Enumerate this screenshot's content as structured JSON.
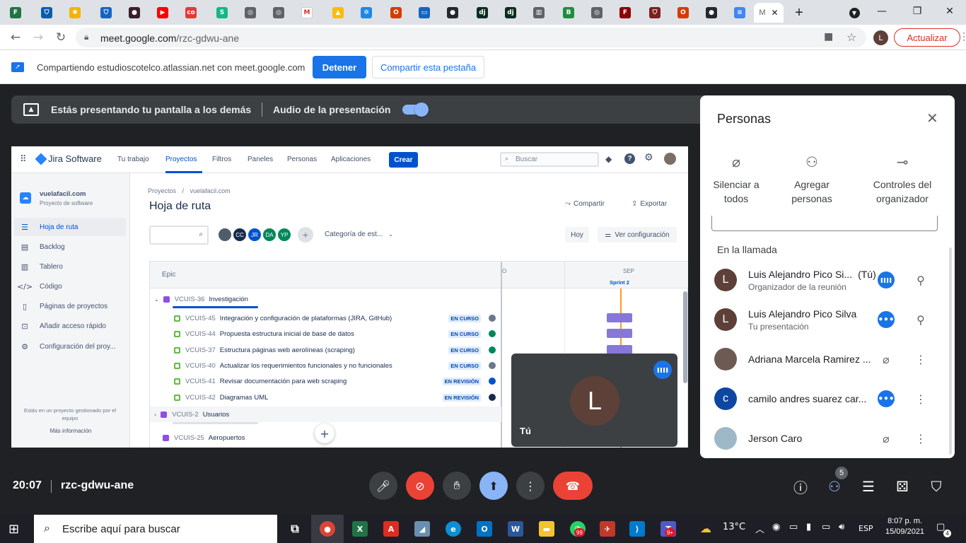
{
  "browser": {
    "address": {
      "domain": "meet.google.com",
      "path": "/rzc-gdwu-ane"
    },
    "profile_initial": "L",
    "update_label": "Actualizar",
    "tab_active_title": "M",
    "new_tab": "+",
    "window_controls": {
      "minimize": "—",
      "restore": "❐",
      "close": "✕"
    }
  },
  "share_bar": {
    "text": "Compartiendo estudioscotelco.atlassian.net con meet.google.com",
    "stop_label": "Detener",
    "share_tab_label": "Compartir esta pestaña"
  },
  "presenting": {
    "text": "Estás presentando tu pantalla a los demás",
    "audio_label": "Audio de la presentación",
    "audio_on": true
  },
  "jira": {
    "brand": "Jira Software",
    "nav": [
      "Tu trabajo",
      "Proyectos",
      "Filtros",
      "Paneles",
      "Personas",
      "Aplicaciones"
    ],
    "create_label": "Crear",
    "search_placeholder": "Buscar",
    "project_name": "vuelafacil.com",
    "project_type": "Proyecto de software",
    "sidebar": [
      {
        "label": "Hoja de ruta",
        "icon": "roadmap-icon"
      },
      {
        "label": "Backlog",
        "icon": "backlog-icon"
      },
      {
        "label": "Tablero",
        "icon": "board-icon"
      },
      {
        "label": "Código",
        "icon": "code-icon"
      },
      {
        "label": "Páginas de proyectos",
        "icon": "pages-icon"
      },
      {
        "label": "Añadir acceso rápido",
        "icon": "shortcut-icon"
      },
      {
        "label": "Configuración del proy...",
        "icon": "settings-icon"
      }
    ],
    "managed_note": "Estás en un proyecto gestionado por el equipo",
    "more_info": "Más información",
    "breadcrumb": [
      "Proyectos",
      "/",
      "vuelafacil.com"
    ],
    "page_title": "Hoja de ruta",
    "share_label": "Compartir",
    "export_label": "Exportar",
    "avatars": [
      "CC",
      "JR",
      "DA",
      "YP"
    ],
    "category_label": "Categoría de est...",
    "today_label": "Hoy",
    "view_config_label": "Ver configuración",
    "column_epic": "Epic",
    "month_prev": "O",
    "month_label": "SEP",
    "sprint_label": "Sprint 2",
    "epics": [
      {
        "key": "VCUIS-36",
        "name": "Investigación"
      },
      {
        "key": "VCUIS-2",
        "name": "Usuarios"
      },
      {
        "key": "VCUIS-25",
        "name": "Aeropuertos"
      }
    ],
    "issues": [
      {
        "key": "VCUIS-45",
        "name": "Integración y configuración de plataformas (JIRA, GitHub)",
        "status": "EN CURSO",
        "color": "#6b778c"
      },
      {
        "key": "VCUIS-44",
        "name": "Propuesta estructura inicial de base de datos",
        "status": "EN CURSO",
        "color": "#00875a"
      },
      {
        "key": "VCUIS-37",
        "name": "Estructura páginas web aerolíneas (scraping)",
        "status": "EN CURSO",
        "color": "#00875a"
      },
      {
        "key": "VCUIS-40",
        "name": "Actualizar los requerimientos funcionales y no funcionales",
        "status": "EN CURSO",
        "color": "#6b778c"
      },
      {
        "key": "VCUIS-41",
        "name": "Revisar documentación para web scraping",
        "status": "EN REVISIÓN",
        "color": "#0052cc"
      },
      {
        "key": "VCUIS-42",
        "name": "Diagramas UML",
        "status": "EN REVISIÓN",
        "color": "#172b4d"
      }
    ]
  },
  "self_tile": {
    "initial": "L",
    "label": "Tú"
  },
  "people_panel": {
    "title": "Personas",
    "actions": [
      {
        "label1": "Silenciar a",
        "label2": "todos"
      },
      {
        "label1": "Agregar",
        "label2": "personas"
      },
      {
        "label1": "Controles del",
        "label2": "organizador"
      }
    ],
    "in_call_label": "En la llamada",
    "people": [
      {
        "name": "Luis Alejandro Pico Si...",
        "suffix": "(Tú)",
        "sub": "Organizador de la reunión",
        "initial": "L",
        "avatar_color": "#5d4037"
      },
      {
        "name": "Luis Alejandro Pico Silva",
        "suffix": "",
        "sub": "Tu presentación",
        "initial": "L",
        "avatar_color": "#5d4037"
      },
      {
        "name": "Adriana Marcela Ramirez ...",
        "suffix": "",
        "sub": "",
        "initial": "",
        "avatar_color": "#6d5a52"
      },
      {
        "name": "camilo andres suarez car...",
        "suffix": "",
        "sub": "",
        "initial": "c",
        "avatar_color": "#0d47a1"
      },
      {
        "name": "Jerson Caro",
        "suffix": "",
        "sub": "",
        "initial": "",
        "avatar_color": "#9fb8c8"
      }
    ]
  },
  "meeting": {
    "time": "20:07",
    "code": "rzc-gdwu-ane",
    "participant_count": "5"
  },
  "taskbar": {
    "search_placeholder": "Escribe aquí para buscar",
    "temperature": "13°C",
    "language": "ESP",
    "time": "8:07 p. m.",
    "date": "15/09/2021",
    "notif_count": "4",
    "whatsapp_badge": "99",
    "teams_badge": "9+"
  }
}
